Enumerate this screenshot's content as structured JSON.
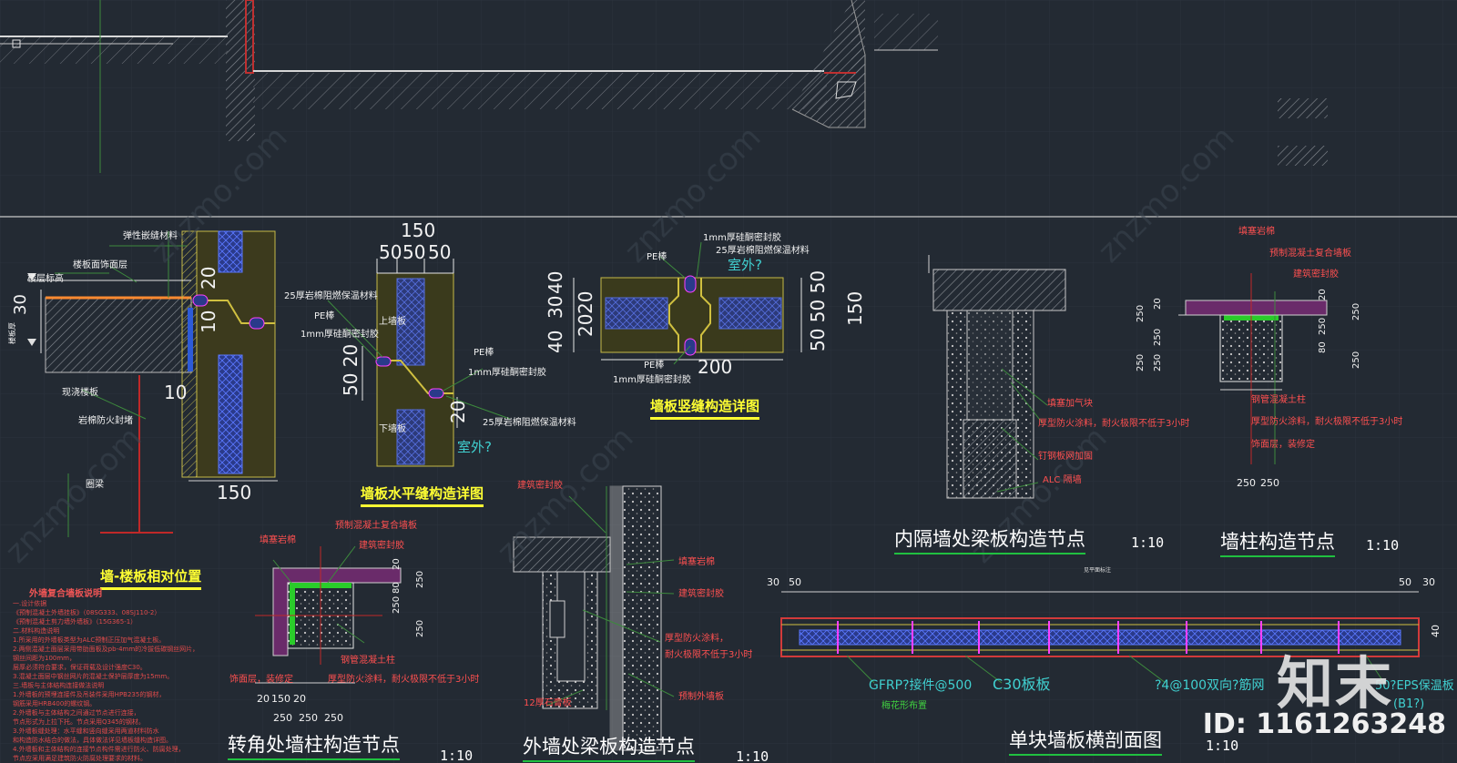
{
  "drawing": {
    "titles": {
      "wall_floor_position": "墙-楼板相对位置",
      "horizontal_joint": "墙板水平缝构造详图",
      "vertical_joint": "墙板竖缝构造详图",
      "interior_wall_beam": "内隔墙处梁板构造节点",
      "wall_column": "墙柱构造节点",
      "corner_column": "转角处墙柱构造节点",
      "exterior_beam": "外墙处梁板构造节点",
      "single_panel_section": "单块墙板横剖面图"
    },
    "scale": "1:10",
    "tiny_label": "见平面标注",
    "notes": {
      "heading": "外墙复合墙板说明",
      "lines": [
        "一.设计依据",
        "《预制混凝土外墙挂板》（08SG333、08SJ110-2）",
        "《预制混凝土剪力墙外墙板》（15G365-1）",
        "二.材料构造说明",
        "1.所采用的外墙板类型为ALC预制正压加气混凝土板。",
        "2.两侧混凝土面层采用带肋面板及pb-4mm的冷拔低碳钢丝网片，钢丝间距为100mm，",
        "  层厚必须符合要求，保证荷载及设计强度C30。",
        "3.混凝土面层中钢丝网片的混凝土保护层厚度为15mm。",
        "三.墙板与主体结构连接做法说明",
        "1.外墙板的预埋连接件及吊装件采用HPB235的钢材，",
        "  钢筋采用HRB400的螺纹钢。",
        "2.外墙板与主体结构之间通过节点进行连接，",
        "  节点形式为上拉下托。节点采用Q345的钢材。",
        "3.外墙板缝处理：水平缝和竖向缝采用两道材料防水",
        "  和构造防水结合的做法，具体做法详见墙板缝构造详图。",
        "4.外墙板和主体结构的连接节点构件需进行防火、防腐处理，",
        "  节点应采用满足建筑防火防腐处理要求的材料。"
      ]
    },
    "labels": {
      "rock_wool_fire_seal": "岩棉防火封堵",
      "floor_finish": "楼板面饰面层",
      "elastic_seal": "弹性嵌缝材料",
      "floor_height": "楼层标高",
      "floor_thick": "楼板厚",
      "cast_slab": "现浇楼板",
      "ring_beam": "圈梁",
      "pe_rod": "PE棒",
      "silicone": "1mm厚硅酮密封胶",
      "rock_wool_25": "25厚岩棉阻燃保温材料",
      "rock_wool_25_b": "25厚岩棉阻燃保温材料",
      "upper_panel": "上墙板",
      "lower_panel": "下墙板",
      "outdoor": "室外?",
      "fill_block": "填塞加气块",
      "fire_coat": "厚型防火涂料，耐火极限不低于3小时",
      "nail_mesh": "钉钢板网加固",
      "alc_wall": "ALC 隔墙",
      "fill_rock": "填塞岩棉",
      "precast_composite": "预制混凝土复合墙板",
      "arch_sealant": "建筑密封胶",
      "steel_concrete_col": "钢管混凝土柱",
      "finish_layer": "饰面层，装修定",
      "fire_coat_2a": "厚型防火涂料，",
      "fire_coat_2b": "耐火极限不低于3小时",
      "precast_ext": "预制外墙板",
      "gypsum": "12厚石膏板",
      "gfrp": "GFRP?接件@500",
      "plum_layout": "梅花形布置",
      "c30": "C30板板",
      "rebar_mesh": "?4@100双向?筋网",
      "eps": "50?EPS保温板",
      "b1": "(B1?)"
    },
    "dims": {
      "d150": "150",
      "d50": "50",
      "d40": "40",
      "d30": "30",
      "d20": "20",
      "d10": "10",
      "d200": "200",
      "d250": "250",
      "d80": "80",
      "d505050": "50 50 50",
      "d5020": "50 20"
    },
    "watermark": "znzmo.com",
    "watermark_cn": "知末网",
    "logo": "知末",
    "id": "ID: 1161263248"
  }
}
